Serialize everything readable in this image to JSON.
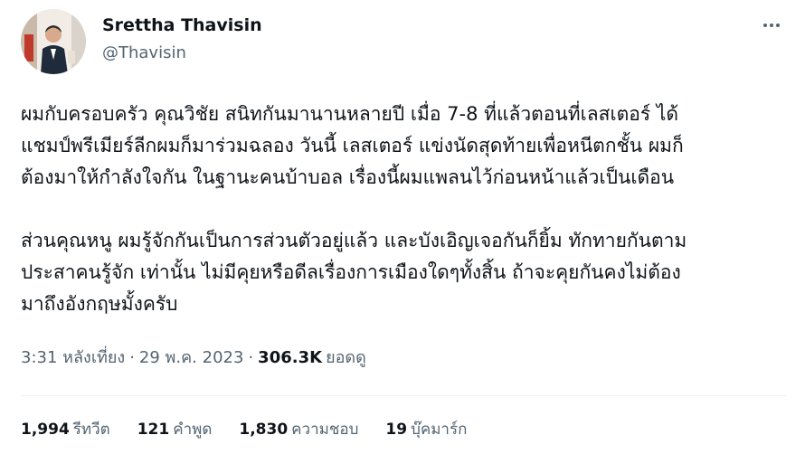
{
  "author": {
    "name": "Srettha Thavisin",
    "handle": "@Thavisin"
  },
  "tweet": {
    "paragraphs": [
      {
        "lines": [
          "ผมกับครอบครัว คุณวิชัย สนิทกันมานานหลายปี  เมื่อ 7-8 ที่แล้วตอนที่เลสเตอร์ ได้",
          "แชมป์พรีเมียร์ลีกผมก็มาร่วมฉลอง  วันนี้ เลสเตอร์ แข่งนัดสุดท้ายเพื่อหนีตกชั้น ผมก็",
          "ต้องมาให้กำลังใจกัน ในฐานะคนบ้าบอล  เรื่องนี้ผมแพลนไว้ก่อนหน้าแล้วเป็นเดือน"
        ]
      },
      {
        "lines": [
          "ส่วนคุณหนู ผมรู้จักกันเป็นการส่วนตัวอยู่แล้ว และบังเอิญเจอกันก็ยิ้ม ทักทายกันตาม",
          "ประสาคนรู้จัก เท่านั้น ไม่มีคุยหรือดีลเรื่องการเมืองใดๆทั้งสิ้น ถ้าจะคุยกันคงไม่ต้อง",
          "มาถึงอังกฤษมั้งครับ"
        ]
      }
    ]
  },
  "meta": {
    "time": "3:31 หลังเที่ยง",
    "separator": "·",
    "date": "29 พ.ค. 2023",
    "views_count": "306.3K",
    "views_label": "ยอดดู"
  },
  "stats": [
    {
      "count": "1,994",
      "label": "รีทวีต"
    },
    {
      "count": "121",
      "label": "คำพูด"
    },
    {
      "count": "1,830",
      "label": "ความชอบ"
    },
    {
      "count": "19",
      "label": "บุ๊คมาร์ก"
    }
  ],
  "icons": {
    "more": "more-options-icon"
  },
  "colors": {
    "text_primary": "#0f1419",
    "text_secondary": "#536471",
    "divider": "#eff3f4"
  }
}
